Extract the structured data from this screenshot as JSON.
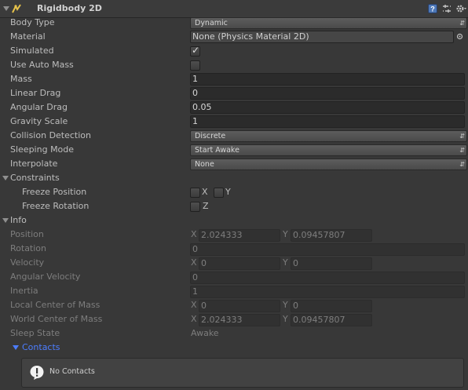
{
  "header": {
    "title": "Rigidbody 2D"
  },
  "body_type": {
    "label": "Body Type",
    "value": "Dynamic"
  },
  "material": {
    "label": "Material",
    "value": "None (Physics Material 2D)"
  },
  "simulated": {
    "label": "Simulated",
    "checked": true
  },
  "use_auto_mass": {
    "label": "Use Auto Mass",
    "checked": false
  },
  "mass": {
    "label": "Mass",
    "value": "1"
  },
  "linear_drag": {
    "label": "Linear Drag",
    "value": "0"
  },
  "angular_drag": {
    "label": "Angular Drag",
    "value": "0.05"
  },
  "gravity_scale": {
    "label": "Gravity Scale",
    "value": "1"
  },
  "collision_detection": {
    "label": "Collision Detection",
    "value": "Discrete"
  },
  "sleeping_mode": {
    "label": "Sleeping Mode",
    "value": "Start Awake"
  },
  "interpolate": {
    "label": "Interpolate",
    "value": "None"
  },
  "constraints": {
    "label": "Constraints",
    "freeze_position": {
      "label": "Freeze Position",
      "x": "X",
      "y": "Y"
    },
    "freeze_rotation": {
      "label": "Freeze Rotation",
      "z": "Z"
    }
  },
  "info": {
    "label": "Info",
    "position": {
      "label": "Position",
      "x": "2.024333",
      "y": "0.09457807"
    },
    "rotation": {
      "label": "Rotation",
      "value": "0"
    },
    "velocity": {
      "label": "Velocity",
      "x": "0",
      "y": "0"
    },
    "angular_velocity": {
      "label": "Angular Velocity",
      "value": "0"
    },
    "inertia": {
      "label": "Inertia",
      "value": "1"
    },
    "local_center_of_mass": {
      "label": "Local Center of Mass",
      "x": "0",
      "y": "0"
    },
    "world_center_of_mass": {
      "label": "World Center of Mass",
      "x": "2.024333",
      "y": "0.09457807"
    },
    "sleep_state": {
      "label": "Sleep State",
      "value": "Awake"
    },
    "x_label": "X",
    "y_label": "Y"
  },
  "contacts": {
    "label": "Contacts",
    "empty_text": "No Contacts"
  },
  "colors": {
    "background": "#383838",
    "accent_link": "#4c7dff"
  }
}
